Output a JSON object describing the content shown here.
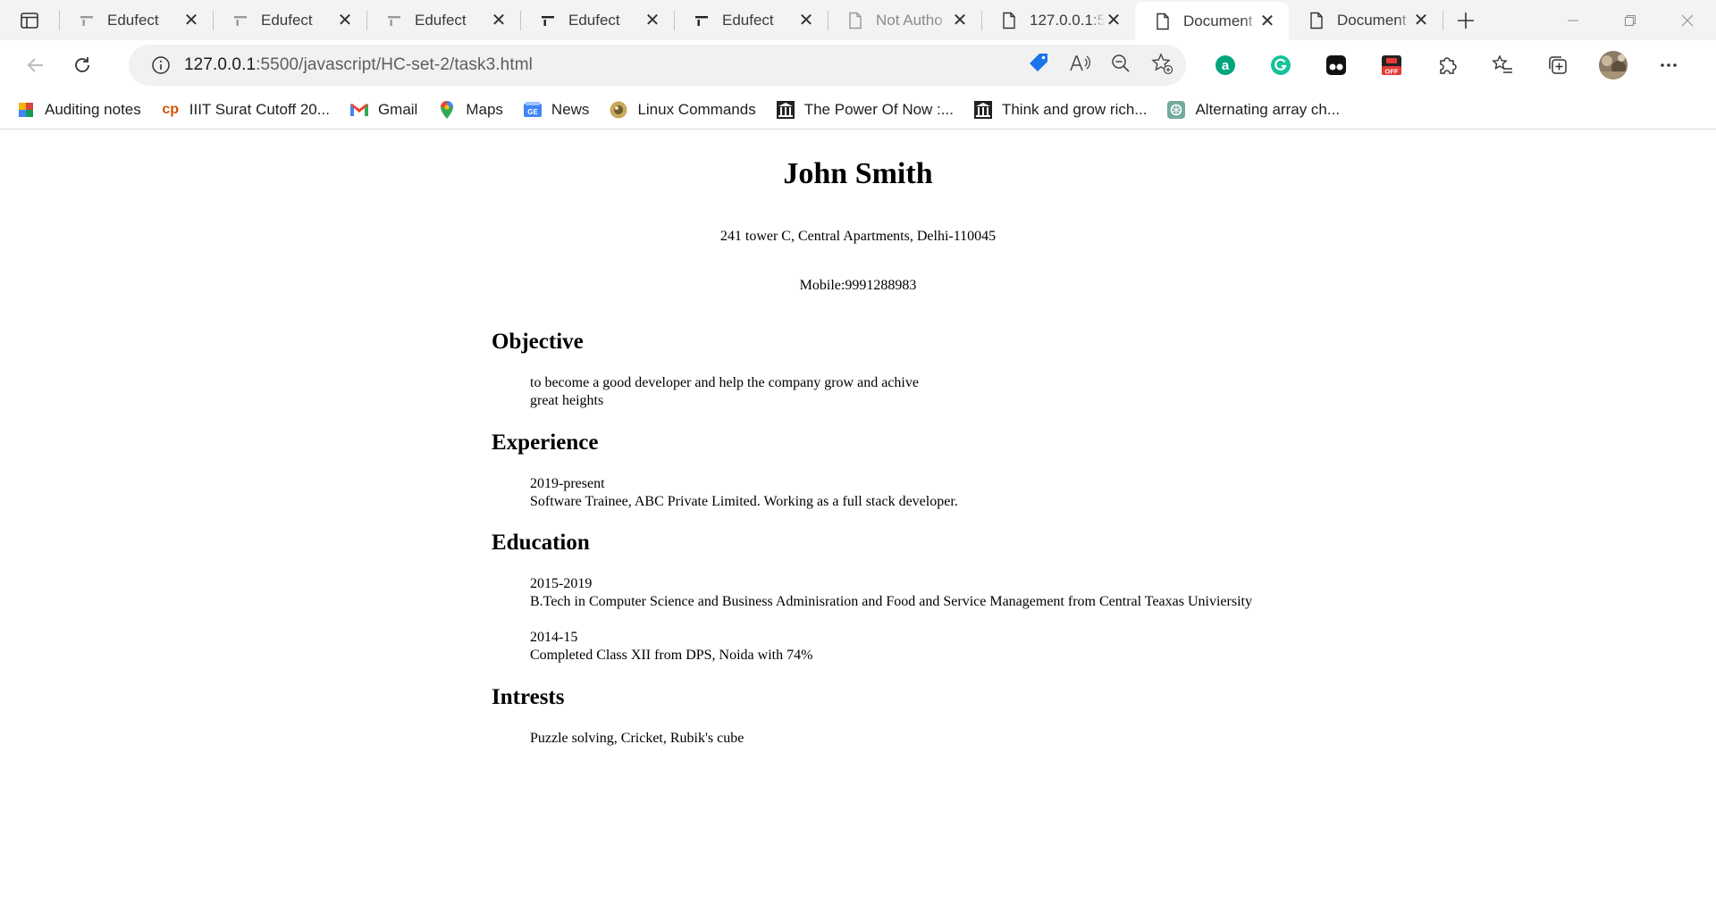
{
  "browser": {
    "tabs": [
      {
        "title": "Edufect",
        "icon": "edufect-favicon"
      },
      {
        "title": "Edufect",
        "icon": "edufect-favicon"
      },
      {
        "title": "Edufect",
        "icon": "edufect-favicon"
      },
      {
        "title": "Edufect",
        "icon": "edufect-favicon"
      },
      {
        "title": "Edufect",
        "icon": "edufect-favicon"
      },
      {
        "title": "Not Autho",
        "icon": "page-icon"
      },
      {
        "title": "127.0.0.1:5",
        "icon": "page-icon"
      },
      {
        "title": "Document",
        "icon": "page-icon",
        "active": true
      },
      {
        "title": "Document",
        "icon": "page-icon"
      }
    ],
    "address": {
      "host": "127.0.0.1",
      "path": ":5500/javascript/HC-set-2/task3.html"
    },
    "favorites": [
      {
        "label": "Auditing notes",
        "icon": "bookmark-color-icon"
      },
      {
        "label": "IIIT Surat Cutoff 20...",
        "icon": "cp-icon"
      },
      {
        "label": "Gmail",
        "icon": "gmail-icon"
      },
      {
        "label": "Maps",
        "icon": "maps-icon"
      },
      {
        "label": "News",
        "icon": "news-icon"
      },
      {
        "label": "Linux Commands",
        "icon": "linux-icon"
      },
      {
        "label": "The Power Of Now :...",
        "icon": "library-icon"
      },
      {
        "label": "Think and grow rich...",
        "icon": "library-icon"
      },
      {
        "label": "Alternating array ch...",
        "icon": "chatgpt-icon"
      }
    ],
    "colors": {
      "tabstrip_bg": "#f3f3f3",
      "omnibox_bg": "#f1f1f1",
      "accent_blue": "#1a73e8"
    }
  },
  "resume": {
    "name": "John Smith",
    "address": "241 tower C, Central Apartments, Delhi-110045",
    "mobile": "Mobile:9991288983",
    "objective": {
      "heading": "Objective",
      "line1": "to become a good developer and help the company grow and achive",
      "line2": "great heights"
    },
    "experience": {
      "heading": "Experience",
      "period": "2019-present",
      "detail": "Software Trainee, ABC Private Limited. Working as a full stack developer."
    },
    "education": {
      "heading": "Education",
      "entries": [
        {
          "period": "2015-2019",
          "detail": "B.Tech in Computer Science and Business Adminisration and Food and Service Management from Central Teaxas Univiersity"
        },
        {
          "period": "2014-15",
          "detail": "Completed Class XII from DPS, Noida with 74%"
        }
      ]
    },
    "interests": {
      "heading": "Intrests",
      "detail": "Puzzle solving, Cricket, Rubik's cube"
    }
  }
}
